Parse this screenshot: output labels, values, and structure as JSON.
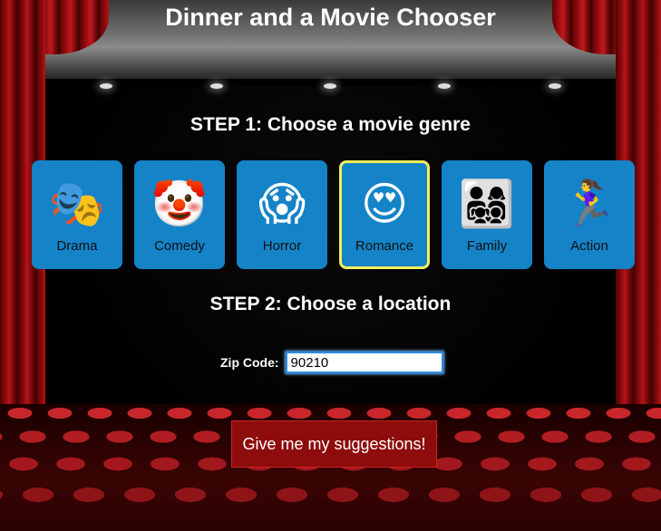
{
  "app": {
    "title": "Dinner and a Movie Chooser"
  },
  "step1": {
    "title": "STEP 1: Choose a movie genre",
    "genres": [
      {
        "label": "Drama",
        "emoji": "🎭",
        "icon": "theater-masks-icon",
        "selected": false
      },
      {
        "label": "Comedy",
        "emoji": "🤡",
        "icon": "clown-face-icon",
        "selected": false
      },
      {
        "label": "Horror",
        "emoji": "😱",
        "icon": "screaming-face-icon",
        "selected": false
      },
      {
        "label": "Romance",
        "emoji": "😍",
        "icon": "heart-eyes-icon",
        "selected": true
      },
      {
        "label": "Family",
        "emoji": "👨‍👩‍👧‍👦",
        "icon": "family-icon",
        "selected": false
      },
      {
        "label": "Action",
        "emoji": "🏃‍♀️",
        "icon": "runner-icon",
        "selected": false
      }
    ]
  },
  "step2": {
    "title": "STEP 2: Choose a location",
    "zip_label": "Zip Code:",
    "zip_value": "90210"
  },
  "submit": {
    "label": "Give me my suggestions!"
  },
  "colors": {
    "genre_tile": "#1583c8",
    "selected_border": "#f3ef5a",
    "button_bg": "#8e0c0c"
  }
}
